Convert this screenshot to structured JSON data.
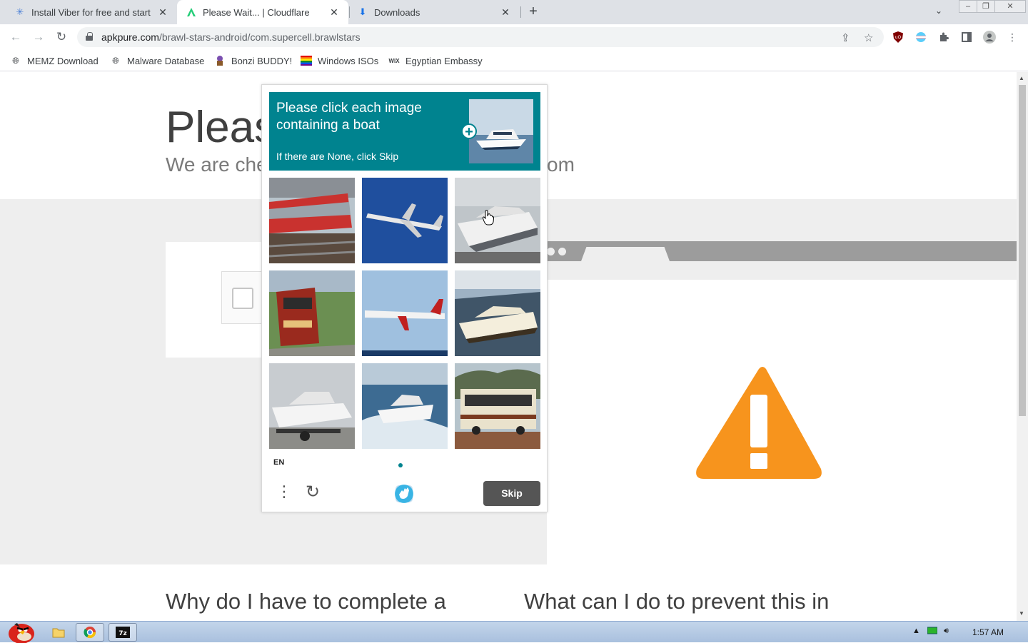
{
  "tabs": [
    {
      "title": "Install Viber for free and start",
      "icon": "viber-snowflake-icon"
    },
    {
      "title": "Please Wait... | Cloudflare",
      "icon": "apkpure-icon",
      "active": true
    },
    {
      "title": "Downloads",
      "icon": "download-icon"
    }
  ],
  "address": {
    "domain": "apkpure.com",
    "path": "/brawl-stars-android/com.supercell.brawlstars"
  },
  "bookmarks": [
    {
      "label": "MEMZ Download",
      "icon": "globe-icon"
    },
    {
      "label": "Malware Database",
      "icon": "globe-icon"
    },
    {
      "label": "Bonzi BUDDY!",
      "icon": "bonzi-icon"
    },
    {
      "label": "Windows ISOs",
      "icon": "rainbow-flag-icon"
    },
    {
      "label": "Egyptian Embassy",
      "icon": "wix-icon",
      "icon_text": "WIX"
    }
  ],
  "page": {
    "title": "Please",
    "subtitle": "We are che",
    "subtitle_end": "om",
    "question_left": "Why do I have to complete a",
    "question_right": "What can I do to prevent this in"
  },
  "captcha": {
    "prompt": "Please click each image containing a boat",
    "hint": "If there are None, click Skip",
    "language": "EN",
    "skip_label": "Skip",
    "tiles": [
      "train",
      "airplane",
      "boat",
      "train",
      "airplane",
      "boat",
      "boat",
      "boat",
      "bus"
    ],
    "accent": "#00838f"
  },
  "taskbar": {
    "clock": "1:57 AM"
  },
  "colors": {
    "warning": "#f7941d",
    "tabstrip": "#dee1e6"
  }
}
